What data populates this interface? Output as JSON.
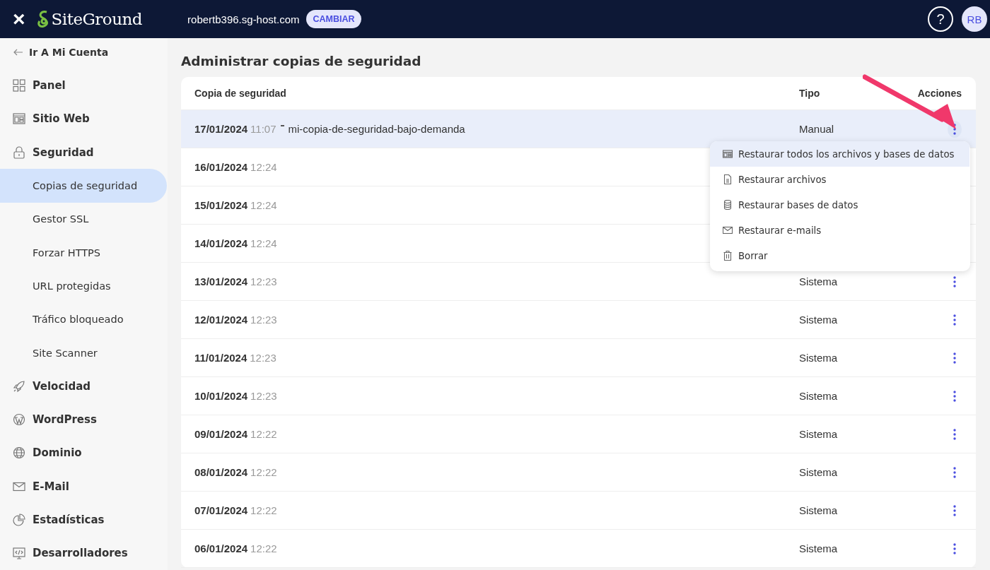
{
  "topbar": {
    "close": "×",
    "logo": "SiteGround",
    "domain": "robertb396.sg-host.com",
    "switch_button": "CAMBIAR",
    "help": "?",
    "avatar": "RB"
  },
  "sidebar": {
    "back": "Ir A Mi Cuenta",
    "items": [
      {
        "label": "Panel",
        "selected": false
      },
      {
        "label": "Sitio Web",
        "selected": false
      },
      {
        "label": "Seguridad",
        "selected": false,
        "children": [
          {
            "label": "Copias de seguridad",
            "selected": true
          },
          {
            "label": "Gestor SSL",
            "selected": false
          },
          {
            "label": "Forzar HTTPS",
            "selected": false
          },
          {
            "label": "URL protegidas",
            "selected": false
          },
          {
            "label": "Tráfico bloqueado",
            "selected": false
          },
          {
            "label": "Site Scanner",
            "selected": false
          }
        ]
      },
      {
        "label": "Velocidad",
        "selected": false
      },
      {
        "label": "WordPress",
        "selected": false
      },
      {
        "label": "Dominio",
        "selected": false
      },
      {
        "label": "E-Mail",
        "selected": false
      },
      {
        "label": "Estadísticas",
        "selected": false
      },
      {
        "label": "Desarrolladores",
        "selected": false
      }
    ]
  },
  "page_title": "Administrar copias de seguridad",
  "table": {
    "columns": [
      "Copia de seguridad",
      "Tipo",
      "Acciones"
    ],
    "rows": [
      {
        "date": "17/01/2024",
        "time": "11:07",
        "name": "mi-copia-de-seguridad-bajo-demanda",
        "type": "Manual",
        "selected": true
      },
      {
        "date": "16/01/2024",
        "time": "12:24",
        "selected": false
      },
      {
        "date": "15/01/2024",
        "time": "12:24",
        "selected": false
      },
      {
        "date": "14/01/2024",
        "time": "12:24",
        "selected": false
      },
      {
        "date": "13/01/2024",
        "time": "12:23",
        "type": "Sistema",
        "selected": false
      },
      {
        "date": "12/01/2024",
        "time": "12:23",
        "type": "Sistema",
        "selected": false
      },
      {
        "date": "11/01/2024",
        "time": "12:23",
        "type": "Sistema",
        "selected": false
      },
      {
        "date": "10/01/2024",
        "time": "12:23",
        "type": "Sistema",
        "selected": false
      },
      {
        "date": "09/01/2024",
        "time": "12:22",
        "type": "Sistema",
        "selected": false
      },
      {
        "date": "08/01/2024",
        "time": "12:22",
        "type": "Sistema",
        "selected": false
      },
      {
        "date": "07/01/2024",
        "time": "12:22",
        "type": "Sistema",
        "selected": false
      },
      {
        "date": "06/01/2024",
        "time": "12:22",
        "type": "Sistema",
        "selected": false
      }
    ]
  },
  "actions_menu": {
    "items": [
      {
        "label": "Restaurar todos los archivos y bases de datos",
        "selected": true
      },
      {
        "label": "Restaurar archivos",
        "selected": false
      },
      {
        "label": "Restaurar bases de datos",
        "selected": false
      },
      {
        "label": "Restaurar e-mails",
        "selected": false
      },
      {
        "label": "Borrar",
        "selected": false
      }
    ]
  }
}
